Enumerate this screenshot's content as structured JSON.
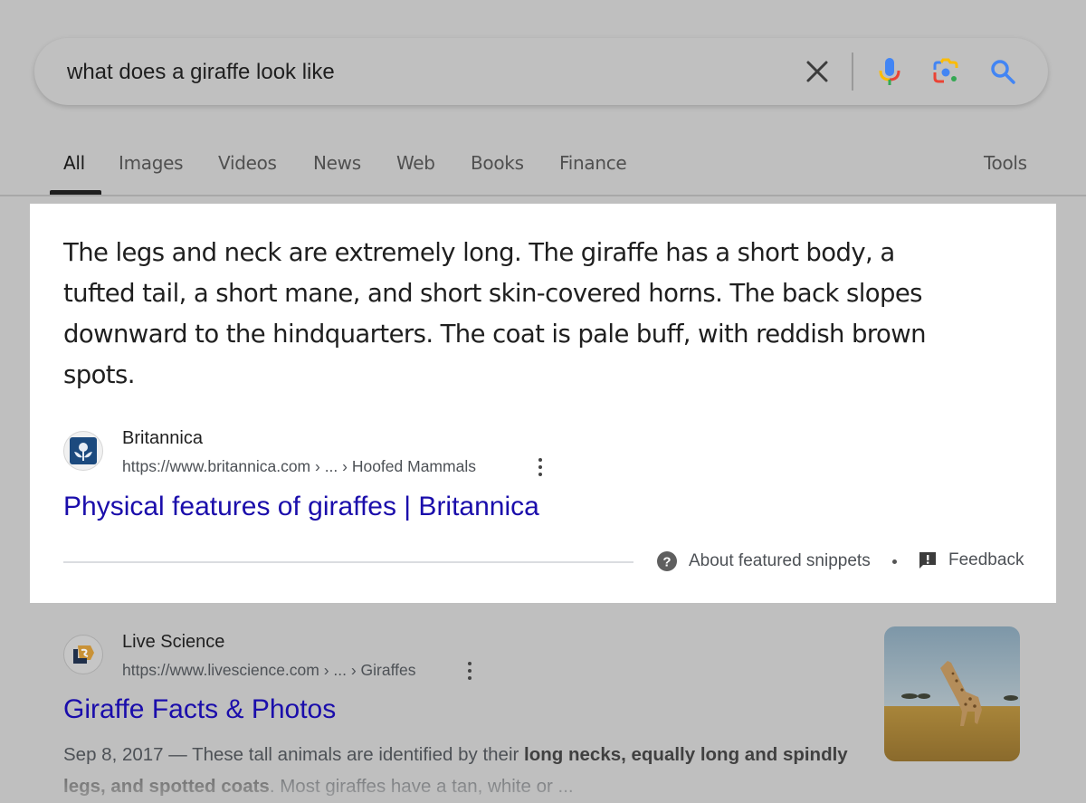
{
  "search": {
    "query": "what does a giraffe look like",
    "icons": [
      "clear-icon",
      "voice-search-icon",
      "lens-icon",
      "search-icon"
    ]
  },
  "tabs": {
    "items": [
      {
        "label": "All",
        "active": true
      },
      {
        "label": "Images"
      },
      {
        "label": "Videos"
      },
      {
        "label": "News"
      },
      {
        "label": "Web"
      },
      {
        "label": "Books"
      },
      {
        "label": "Finance"
      }
    ],
    "tools_label": "Tools"
  },
  "featured_snippet": {
    "text": "The legs and neck are extremely long. The giraffe has a short body, a tufted tail, a short mane, and short skin-covered horns. The back slopes downward to the hindquarters. The coat is pale buff, with reddish brown spots.",
    "source": {
      "name": "Britannica",
      "url": "https://www.britannica.com › ... › Hoofed Mammals",
      "title": "Physical features of giraffes | Britannica"
    },
    "footer": {
      "about_label": "About featured snippets",
      "separator": "•",
      "feedback_label": "Feedback"
    }
  },
  "results": [
    {
      "name": "Live Science",
      "url": "https://www.livescience.com › ... › Giraffes",
      "title": "Giraffe Facts & Photos",
      "date": "Sep 8, 2017",
      "dash": " — ",
      "snippet_pre": "These tall animals are identified by their ",
      "snippet_bold": "long necks, equally long and spindly legs, and spotted coats",
      "snippet_post": ". Most giraffes have a tan, white or ...",
      "thumbnail_alt": "Giraffe walking in savanna grassland"
    }
  ],
  "colors": {
    "link": "#1a0dab",
    "page_dim": "#bfbfbf",
    "highlight": "#ffffff"
  }
}
